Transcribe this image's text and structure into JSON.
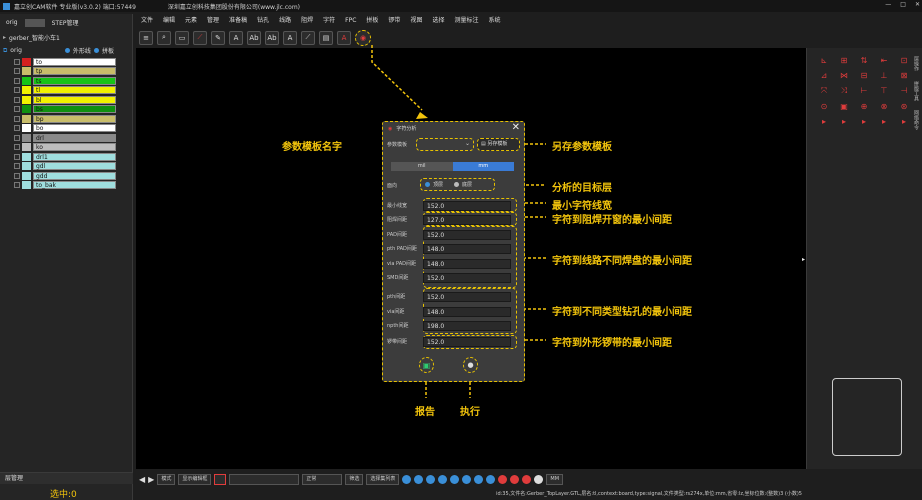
{
  "window": {
    "title": "嘉立创CAM软件 专业版(v3.0.2) 端口:57449",
    "company": "深圳嘉立创科技集团股份有限公司(www.jlc.com)",
    "controls": [
      "—",
      "□",
      "✕"
    ]
  },
  "menu": [
    "文件",
    "编辑",
    "元素",
    "管理",
    "准备稿",
    "钻孔",
    "线路",
    "阻焊",
    "字符",
    "FPC",
    "拼板",
    "锣带",
    "视图",
    "选择",
    "测量标注",
    "系统"
  ],
  "left_panel": {
    "tabs": [
      "orig",
      "STEP管理"
    ],
    "job": "gerber_智能小车1",
    "step": "orig",
    "options": [
      "外形线",
      "拼板"
    ],
    "layers": [
      {
        "name": "to",
        "color": "#d42020",
        "label_bg": "#ffffff"
      },
      {
        "name": "tp",
        "color": "#c8bd6a",
        "label_bg": "#c8bd6a"
      },
      {
        "name": "ts",
        "color": "#17c417",
        "label_bg": "#17c417"
      },
      {
        "name": "tl",
        "color": "#f2f200",
        "label_bg": "#f2f200"
      },
      {
        "name": "bl",
        "color": "#f2f200",
        "label_bg": "#f2f200"
      },
      {
        "name": "bs",
        "color": "#109010",
        "label_bg": "#109010"
      },
      {
        "name": "bp",
        "color": "#c8bd6a",
        "label_bg": "#c8bd6a"
      },
      {
        "name": "bo",
        "color": "#ffffff",
        "label_bg": "#ffffff"
      },
      {
        "name": "drl",
        "color": "#8a8a8a",
        "label_bg": "#8a8a8a"
      },
      {
        "name": "ko",
        "color": "#bdbdbd",
        "label_bg": "#bdbdbd"
      },
      {
        "name": "drl1",
        "color": "#9fdede",
        "label_bg": "#9fdede"
      },
      {
        "name": "gdl",
        "color": "#9fdede",
        "label_bg": "#9fdede"
      },
      {
        "name": "gdd",
        "color": "#9fdede",
        "label_bg": "#9fdede"
      },
      {
        "name": "to_bak",
        "color": "#9fdede",
        "label_bg": "#9fdede"
      }
    ],
    "bottom_tab": "层管理",
    "selected": "选中:0"
  },
  "dialog": {
    "title": "字符分析",
    "template_label": "参数模板",
    "save_template": "另存模板",
    "units": [
      "mil",
      "mm"
    ],
    "side_label": "面向",
    "side_options": [
      "顶层",
      "底层"
    ],
    "fields": [
      {
        "label": "最小线宽",
        "value": "152.0"
      },
      {
        "label": "阻焊间距",
        "value": "127.0"
      },
      {
        "label": "PAD间距",
        "value": "152.0"
      },
      {
        "label": "pth PAD间距",
        "value": "148.0"
      },
      {
        "label": "via PAD间距",
        "value": "148.0"
      },
      {
        "label": "SMD间距",
        "value": "152.0"
      },
      {
        "label": "pth间距",
        "value": "152.0"
      },
      {
        "label": "via间距",
        "value": "148.0"
      },
      {
        "label": "npth间距",
        "value": "198.0"
      },
      {
        "label": "锣带间距",
        "value": "152.0"
      }
    ]
  },
  "annotations": {
    "template_name": "参数模板名字",
    "save_template": "另存参数模板",
    "target_layer": "分析的目标层",
    "min_line": "最小字符线宽",
    "mask": "字符到阻焊开窗的最小间距",
    "pads": "字符到线路不同焊盘的最小间距",
    "holes": "字符到不同类型钻孔的最小间距",
    "rout": "字符到外形锣带的最小间距",
    "report": "报告",
    "execute": "执行"
  },
  "status": {
    "mode": "模式",
    "show_option": "显示编辑框",
    "select_mode": "正常",
    "filter": "筛选",
    "list": "选择集列表",
    "unit": "MM"
  },
  "infoline": "id:35,文件名:Gerber_TopLayer.GTL,层名:tl,context:board,type:signal,文件类型:rs274x,单位:mm,省零:lz,坐标位数:(整数)3 (小数)5",
  "right_panel": {
    "side_labels": [
      "层操作",
      "拼版工具",
      "网络命令"
    ]
  }
}
